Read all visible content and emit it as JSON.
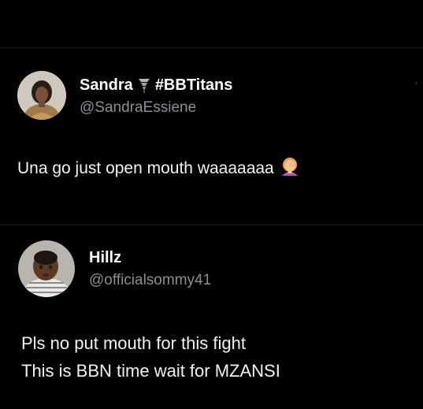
{
  "tweet_1": {
    "display_name": "Sandra",
    "hashtag": "#BBTitans",
    "handle": "@SandraEssiene",
    "text": "Una go just open mouth waaaaaaa"
  },
  "tweet_2": {
    "display_name": "Hillz",
    "handle": "@officialsommy41",
    "text_lines": [
      "Pls no put mouth for this fight",
      "This is BBN time wait for MZANSI"
    ]
  },
  "colors": {
    "background": "#000000",
    "handle": "#8b8f94",
    "text": "#f2f2f2"
  },
  "icons": {
    "name_badge": "tornado-icon",
    "reaction": "facepalm-emoji-icon"
  }
}
